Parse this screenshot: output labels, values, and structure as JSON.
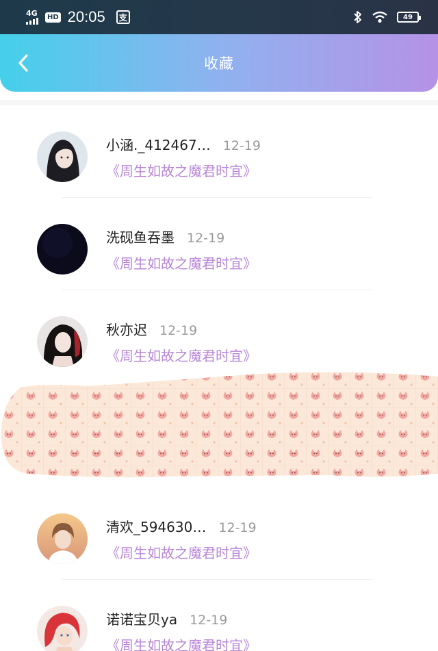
{
  "status_bar": {
    "network": "4G",
    "hd": "HD",
    "time": "20:05",
    "pay_glyph": "支",
    "battery": "49"
  },
  "header": {
    "back_icon": "chevron-left-icon",
    "title": "收藏"
  },
  "favorites": [
    {
      "name": "小涵._412467…",
      "date": "12-19",
      "book": "《周生如故之魔君时宜》"
    },
    {
      "name": "洗砚鱼吞墨",
      "date": "12-19",
      "book": "《周生如故之魔君时宜》"
    },
    {
      "name": "秋亦迟",
      "date": "12-19",
      "book": "《周生如故之魔君时宜》"
    },
    {
      "name": "清欢_594630…",
      "date": "12-19",
      "book": "《周生如故之魔君时宜》"
    },
    {
      "name": "诺诺宝贝ya",
      "date": "12-19",
      "book": "《周生如故之魔君时宜》"
    }
  ],
  "colors": {
    "header_start": "#44d0ea",
    "header_end": "#b592e6",
    "book_title": "#b886d6",
    "censor_base": "#fbe8d8",
    "censor_pattern": "#f2a7a0"
  }
}
